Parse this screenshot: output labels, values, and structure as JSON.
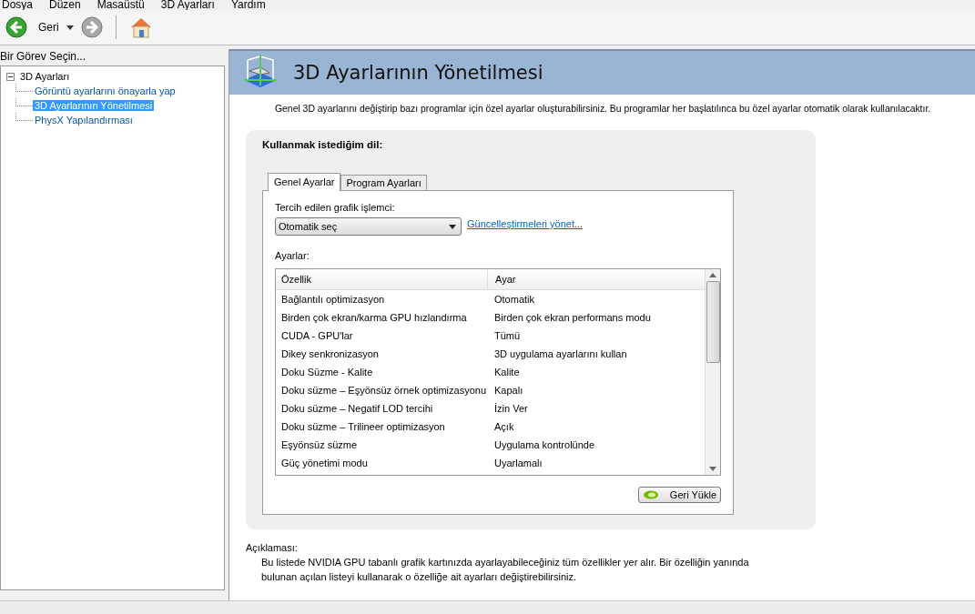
{
  "menu": [
    "Dosya",
    "Düzen",
    "Masaüstü",
    "3D Ayarları",
    "Yardım"
  ],
  "toolbar": {
    "back_label": "Geri"
  },
  "sidebar": {
    "title": "Bir Görev Seçin...",
    "tree": [
      {
        "label": "3D Ayarları",
        "expanded": true,
        "selected": false,
        "children": [
          {
            "label": "Görüntü ayarlarını önayarla yap",
            "selected": false
          },
          {
            "label": "3D Ayarlarının Yönetilmesi",
            "selected": true
          },
          {
            "label": "PhysX Yapılandırması",
            "selected": false
          }
        ]
      }
    ]
  },
  "header": {
    "title": "3D Ayarlarının Yönetilmesi"
  },
  "intro": "Genel 3D ayarlarını değiştirip bazı programlar için özel ayarlar oluşturabilirsiniz. Bu programlar her başlatılınca bu özel ayarlar otomatik olarak kullanılacaktır.",
  "panel": {
    "title": "Kullanmak istediğim dil:",
    "tabs": [
      {
        "label": "Genel Ayarlar",
        "selected": true
      },
      {
        "label": "Program Ayarları",
        "selected": false
      }
    ],
    "gpu_label": "Tercih edilen grafik işlemci:",
    "gpu_dropdown": {
      "value": "Otomatik seç"
    },
    "manage_link": "Güncelleştirmeleri yönet...",
    "settings_label": "Ayarlar:",
    "table": {
      "columns": [
        "Özellik",
        "Ayar"
      ],
      "rows": [
        [
          "Bağlantılı optimizasyon",
          "Otomatik"
        ],
        [
          "Birden çok ekran/karma GPU hızlandırma",
          "Birden çok ekran performans modu"
        ],
        [
          "CUDA - GPU'lar",
          "Tümü"
        ],
        [
          "Dikey senkronizasyon",
          "3D uygulama ayarlarını kullan"
        ],
        [
          "Doku Süzme - Kalite",
          "Kalite"
        ],
        [
          "Doku süzme – Eşyönsüz örnek optimizasyonu",
          "Kapalı"
        ],
        [
          "Doku süzme – Negatif LOD tercihi",
          "İzin Ver"
        ],
        [
          "Doku süzme – Trilineer optimizasyon",
          "Açık"
        ],
        [
          "Eşyönsüz süzme",
          "Uygulama kontrolünde"
        ],
        [
          "Güç yönetimi modu",
          "Uyarlamalı"
        ]
      ]
    },
    "restore_button": "Geri Yükle"
  },
  "description": {
    "label": "Açıklaması:",
    "text": "Bu listede NVIDIA GPU tabanlı grafik kartınızda ayarlayabileceğiniz tüm özellikler yer alır. Bir özelliğin yanında bulunan açılan listeyi kullanarak o özelliğe ait ayarları değiştirebilirsiniz."
  }
}
